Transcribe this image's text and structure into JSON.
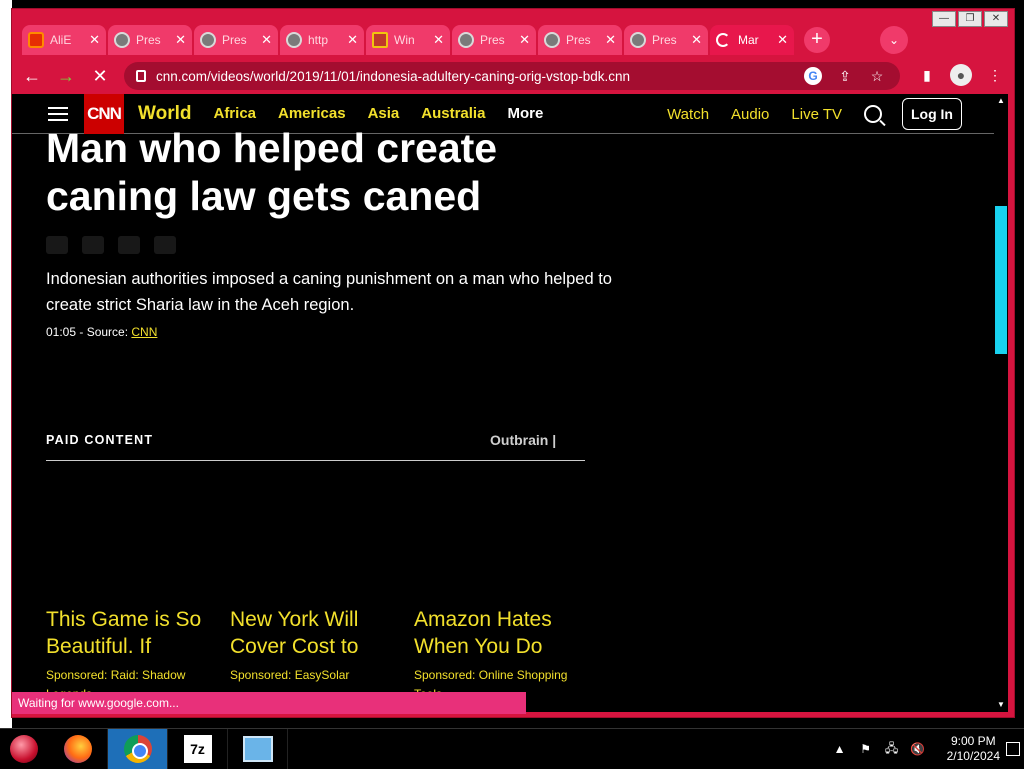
{
  "browser": {
    "tabs": [
      {
        "label": "AliE",
        "favicon": "aliexpress-icon"
      },
      {
        "label": "Pres",
        "favicon": "globe-icon"
      },
      {
        "label": "Pres",
        "favicon": "globe-icon"
      },
      {
        "label": "http",
        "favicon": "globe-icon"
      },
      {
        "label": "Win",
        "favicon": "windows-icon"
      },
      {
        "label": "Pres",
        "favicon": "globe-icon"
      },
      {
        "label": "Pres",
        "favicon": "globe-icon"
      },
      {
        "label": "Pres",
        "favicon": "globe-icon"
      },
      {
        "label": "Mar",
        "favicon": "loading-spinner-icon"
      }
    ],
    "url": "cnn.com/videos/world/2019/11/01/indonesia-adultery-caning-orig-vstop-bdk.cnn",
    "status": "Waiting for www.google.com...",
    "theme_color": "#d6143f"
  },
  "cnn": {
    "logo": "CNN",
    "section": "World",
    "nav_links": [
      "Africa",
      "Americas",
      "Asia",
      "Australia",
      "More"
    ],
    "right_links": [
      "Watch",
      "Audio",
      "Live TV"
    ],
    "login": "Log In",
    "accent_color": "#f2e02c"
  },
  "video": {
    "headline_line1": "Man who helped create",
    "headline_line2": "caning law gets caned",
    "description": "Indonesian authorities imposed a caning punishment on a man who helped to create strict Sharia law in the Aceh region.",
    "duration_source": "01:05 - Source: ",
    "source_link": "CNN"
  },
  "paid_content": {
    "heading": "PAID CONTENT",
    "provider": "Outbrain |",
    "cards": [
      {
        "title": "This Game is So Beautiful. If",
        "sponsor": "Sponsored: Raid: Shadow Legends"
      },
      {
        "title": "New York Will Cover Cost to",
        "sponsor": "Sponsored: EasySolar"
      },
      {
        "title": "Amazon Hates When You Do",
        "sponsor": "Sponsored: Online Shopping Tools"
      }
    ]
  },
  "taskbar": {
    "time": "9:00 PM",
    "date": "2/10/2024",
    "sevenzip_label": "7z"
  }
}
